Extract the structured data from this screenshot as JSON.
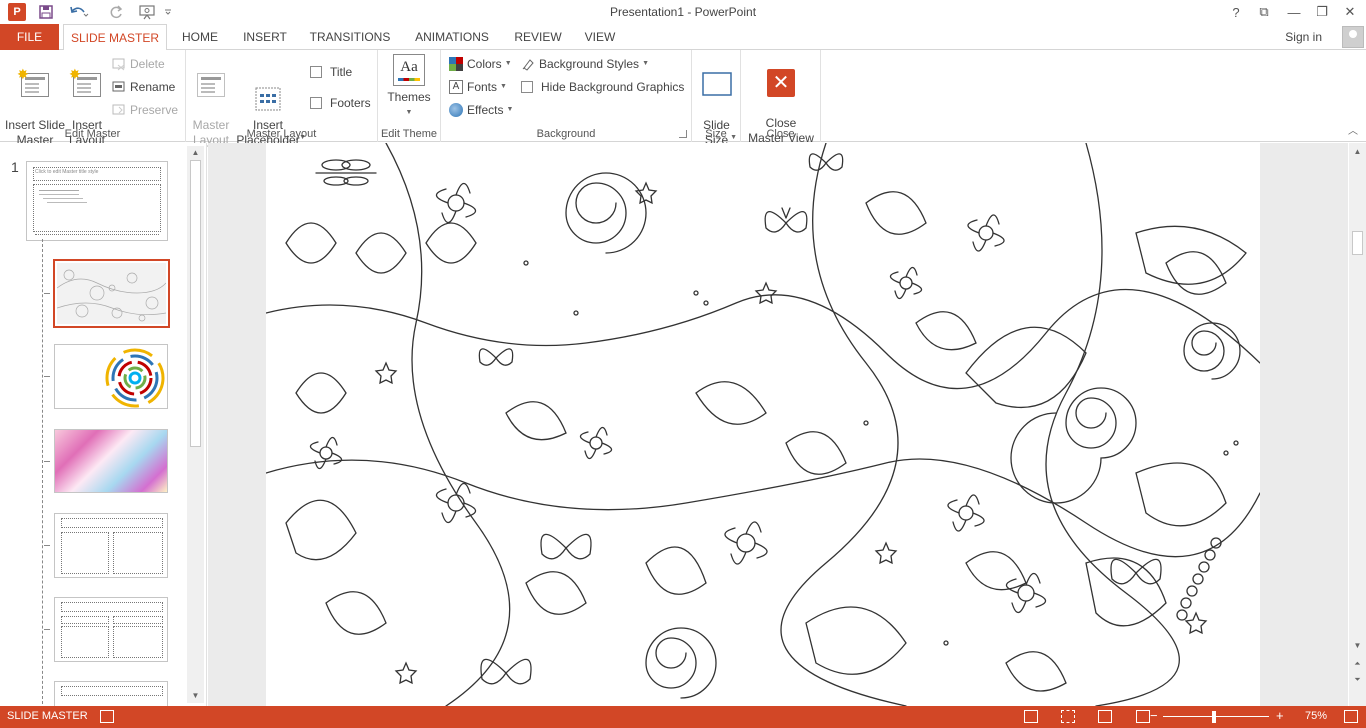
{
  "window": {
    "title": "Presentation1 - PowerPoint",
    "app_icon_letter": "P",
    "controls": [
      "?",
      "⧉",
      "—",
      "❐",
      "✕"
    ]
  },
  "tabs": [
    {
      "label": "FILE"
    },
    {
      "label": "SLIDE MASTER",
      "active": true
    },
    {
      "label": "HOME"
    },
    {
      "label": "INSERT"
    },
    {
      "label": "TRANSITIONS"
    },
    {
      "label": "ANIMATIONS"
    },
    {
      "label": "REVIEW"
    },
    {
      "label": "VIEW"
    }
  ],
  "account": {
    "signin": "Sign in"
  },
  "ribbon": {
    "edit_master": {
      "label": "Edit Master",
      "insert_slide_master": "Insert Slide\nMaster",
      "insert_layout": "Insert\nLayout",
      "delete": "Delete",
      "rename": "Rename",
      "preserve": "Preserve"
    },
    "master_layout": {
      "label": "Master Layout",
      "master_layout": "Master\nLayout",
      "insert_placeholder": "Insert\nPlaceholder",
      "title": "Title",
      "footers": "Footers"
    },
    "edit_theme": {
      "label": "Edit Theme",
      "themes": "Themes",
      "themes_icon_text": "Aa"
    },
    "background": {
      "label": "Background",
      "colors": "Colors",
      "fonts": "Fonts",
      "fonts_icon_text": "A",
      "effects": "Effects",
      "background_styles": "Background Styles",
      "hide_background_graphics": "Hide Background Graphics"
    },
    "size": {
      "label": "Size",
      "slide_size": "Slide\nSize"
    },
    "close": {
      "label": "Close",
      "close_master_view": "Close\nMaster View"
    }
  },
  "thumbnails": {
    "slide_number": "1",
    "master_title_text": "Click to edit Master title style"
  },
  "status": {
    "mode": "SLIDE MASTER",
    "zoom_level": "75%",
    "zoom_minus": "−",
    "zoom_plus": "+"
  },
  "colors": {
    "accent": "#d24726"
  }
}
